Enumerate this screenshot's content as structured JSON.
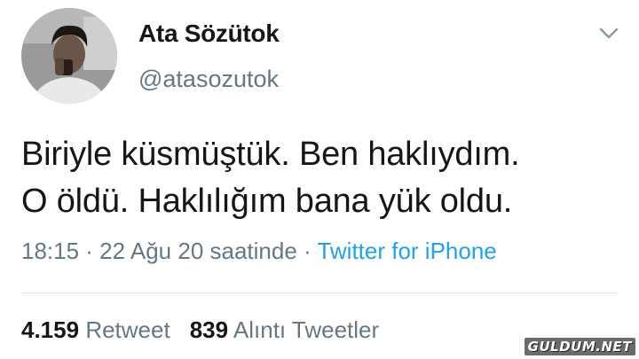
{
  "author": {
    "name": "Ata Sözütok",
    "handle": "@atasozutok"
  },
  "tweet": {
    "lines": [
      "Biriyle küsmüştük. Ben haklıydım.",
      "O öldü. Haklılığım bana yük oldu."
    ]
  },
  "meta": {
    "time_date": "18:15 · 22 Ağu 20 saatinde",
    "separator": " · ",
    "source": "Twitter for iPhone"
  },
  "stats": {
    "retweets_count": "4.159",
    "retweets_label": "Retweet",
    "quotes_count": "839",
    "quotes_label": "Alıntı Tweetler"
  },
  "icons": {
    "menu": "chevron-down-icon"
  },
  "colors": {
    "text": "#14171a",
    "secondary": "#657786",
    "link": "#1da1f2",
    "divider": "#e1e8ed"
  },
  "watermark": "GULDUM.NET"
}
